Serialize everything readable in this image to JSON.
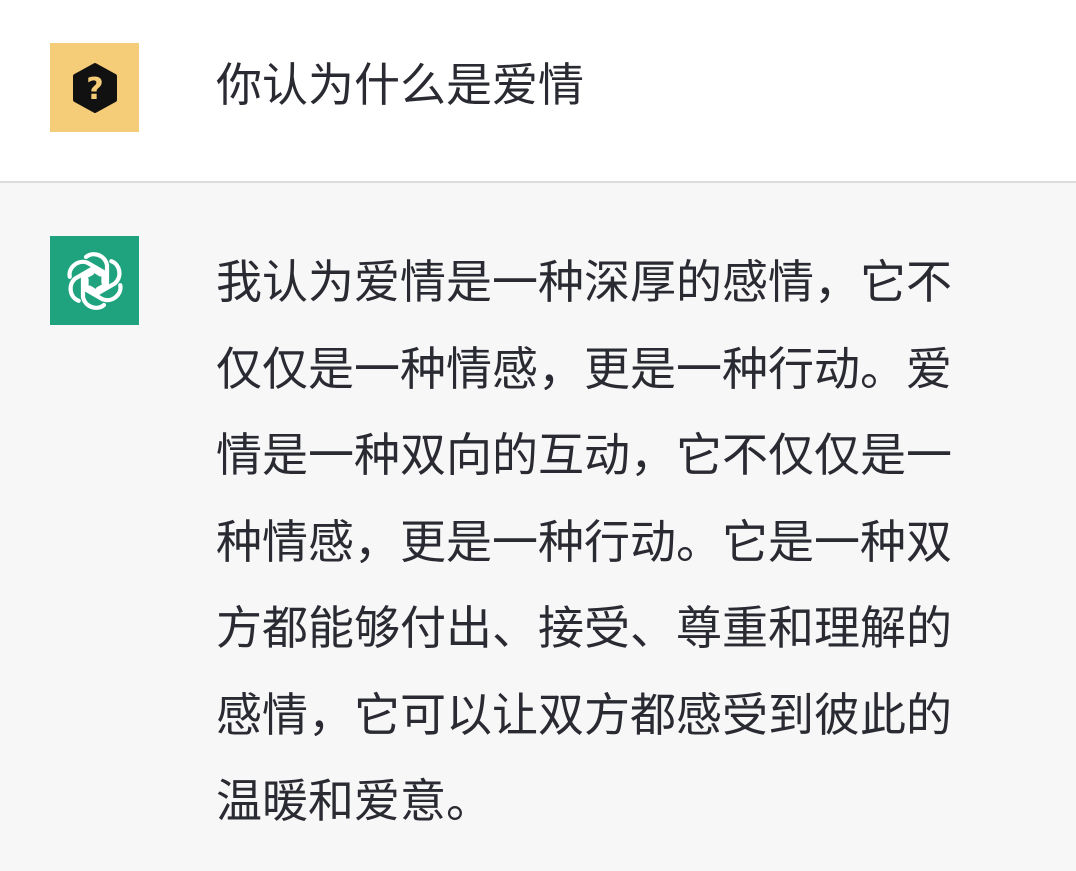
{
  "conversation": {
    "user_message": {
      "avatar_icon": "question-hexagon-icon",
      "avatar_color": "#f5cd78",
      "text": "你认为什么是爱情"
    },
    "assistant_message": {
      "avatar_icon": "openai-logo-icon",
      "avatar_color": "#1fa37f",
      "lines": [
        "我认为爱情是一种深厚的感情，它不",
        "仅仅是一种情感，更是一种行动。爱",
        "情是一种双向的互动，它不仅仅是一",
        "种情感，更是一种行动。它是一种双",
        "方都能够付出、接受、尊重和理解的",
        "感情，它可以让双方都感受到彼此的",
        "温暖和爱意。"
      ]
    }
  }
}
